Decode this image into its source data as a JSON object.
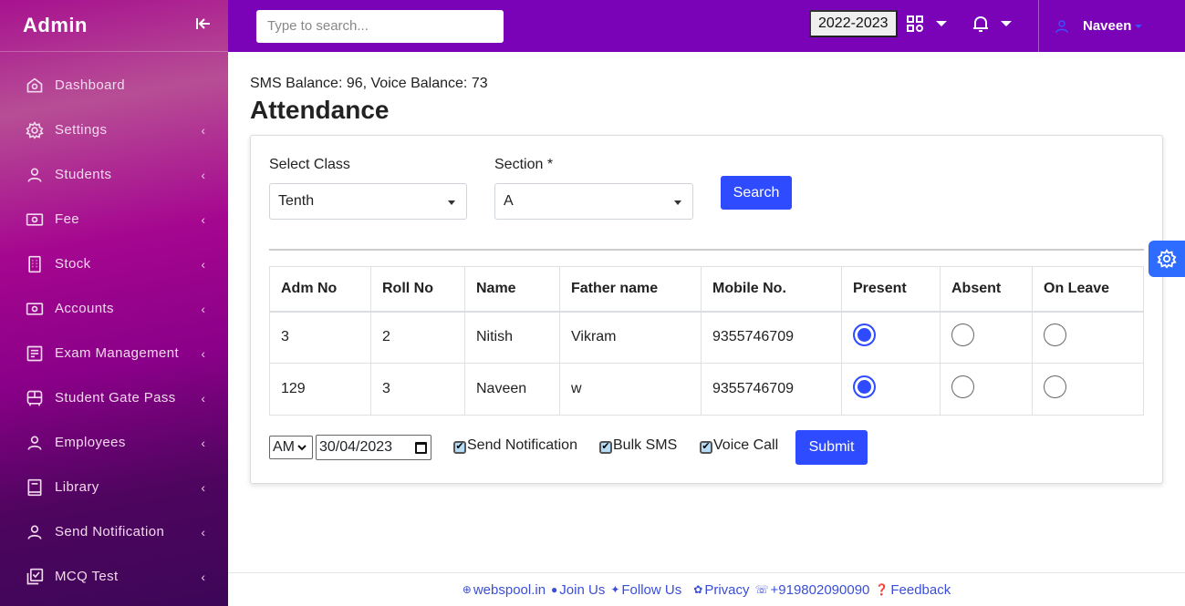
{
  "sidebar": {
    "brand": "Admin",
    "collapse_icon": "collapse-left-icon",
    "items": [
      {
        "label": "Dashboard",
        "icon": "home-icon",
        "has_submenu": false
      },
      {
        "label": "Settings",
        "icon": "gear-icon",
        "has_submenu": true
      },
      {
        "label": "Students",
        "icon": "user-icon",
        "has_submenu": true
      },
      {
        "label": "Fee",
        "icon": "money-icon",
        "has_submenu": true
      },
      {
        "label": "Stock",
        "icon": "building-icon",
        "has_submenu": true
      },
      {
        "label": "Accounts",
        "icon": "money-icon",
        "has_submenu": true
      },
      {
        "label": "Exam Management",
        "icon": "document-icon",
        "has_submenu": true
      },
      {
        "label": "Student Gate Pass",
        "icon": "bus-icon",
        "has_submenu": true
      },
      {
        "label": "Employees",
        "icon": "user-icon",
        "has_submenu": true
      },
      {
        "label": "Library",
        "icon": "book-icon",
        "has_submenu": true
      },
      {
        "label": "Send Notification",
        "icon": "user-icon",
        "has_submenu": true
      },
      {
        "label": "MCQ Test",
        "icon": "checklist-icon",
        "has_submenu": true
      }
    ],
    "chevron": "‹"
  },
  "topbar": {
    "search_placeholder": "Type to search...",
    "session": "2022-2023",
    "user_name": "Naveen"
  },
  "main": {
    "balance": "SMS Balance: 96, Voice Balance: 73",
    "title": "Attendance",
    "filters": {
      "class_label": "Select Class",
      "class_value": "Tenth",
      "section_label": "Section *",
      "section_value": "A",
      "search_button": "Search"
    },
    "table": {
      "headers": [
        "Adm No",
        "Roll No",
        "Name",
        "Father name",
        "Mobile No.",
        "Present",
        "Absent",
        "On Leave"
      ],
      "rows": [
        {
          "adm_no": "3",
          "roll_no": "2",
          "name": "Nitish",
          "father": "Vikram",
          "mobile": "9355746709",
          "status": "present"
        },
        {
          "adm_no": "129",
          "roll_no": "3",
          "name": "Naveen",
          "father": "w",
          "mobile": "9355746709",
          "status": "present"
        }
      ]
    },
    "bottom": {
      "ampm": "AM",
      "date": "30/04/2023",
      "send_notification": {
        "label": "Send Notification",
        "checked": true
      },
      "bulk_sms": {
        "label": "Bulk SMS",
        "checked": true
      },
      "voice_call": {
        "label": "Voice Call",
        "checked": true
      },
      "submit": "Submit"
    }
  },
  "footer": {
    "links": [
      {
        "icon": "globe-icon",
        "glyph": "⊕",
        "label": "webspool.in"
      },
      {
        "icon": "facebook-icon",
        "glyph": "●",
        "label": "Join Us"
      },
      {
        "icon": "twitter-icon",
        "glyph": "✦",
        "label": "Follow Us"
      },
      {
        "icon": "cookie-icon",
        "glyph": "✿",
        "label": "Privacy"
      },
      {
        "icon": "phone-icon",
        "glyph": "☏",
        "label": "+919802090090"
      },
      {
        "icon": "question-icon",
        "glyph": "❓",
        "label": "Feedback"
      }
    ]
  },
  "colors": {
    "topbar": "#7a03b7",
    "accent": "#2e4bff",
    "link": "#3b4ed8"
  }
}
